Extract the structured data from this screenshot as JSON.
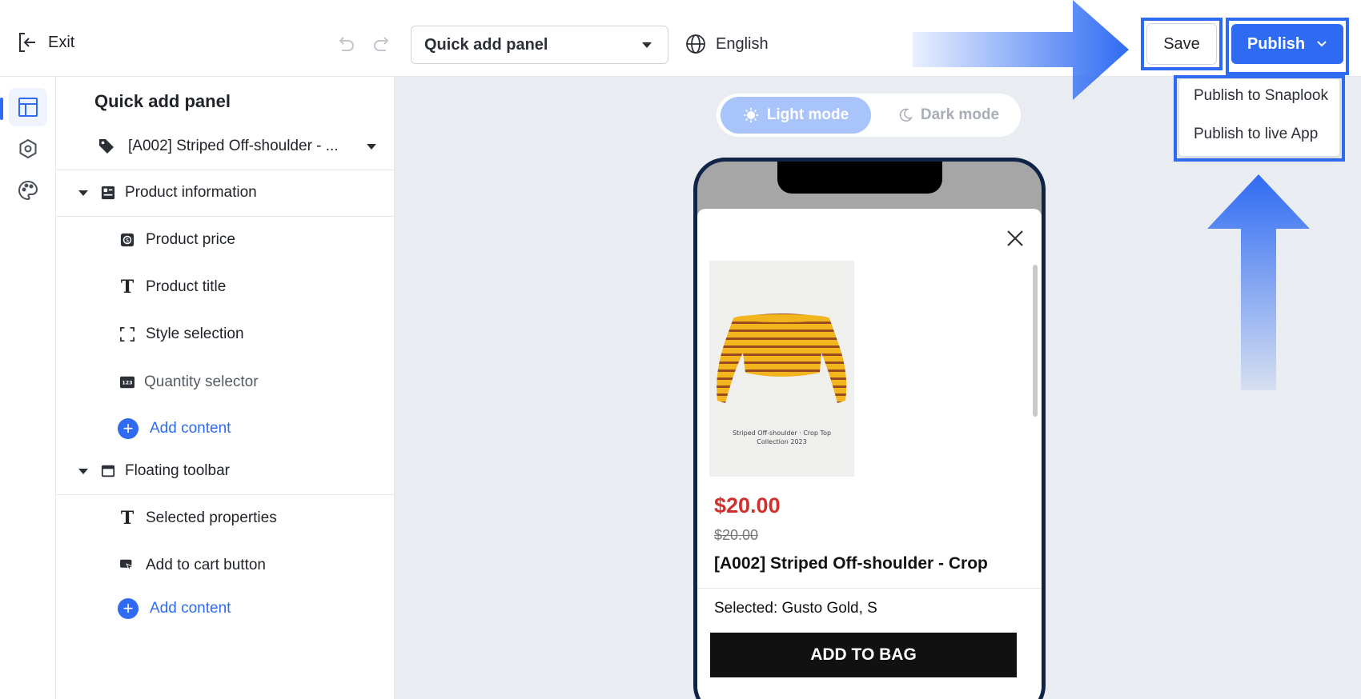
{
  "topbar": {
    "exit_label": "Exit",
    "panel_select_value": "Quick add panel",
    "language": "English",
    "save_label": "Save",
    "publish_label": "Publish"
  },
  "publish_menu": {
    "items": [
      "Publish to Snaplook",
      "Publish to live App"
    ]
  },
  "rail": {
    "items": [
      {
        "icon": "layout-icon",
        "active": true
      },
      {
        "icon": "settings-hex-icon",
        "active": false
      },
      {
        "icon": "palette-icon",
        "active": false
      }
    ]
  },
  "sidebar": {
    "title": "Quick add panel",
    "product_picker": "[A002] Striped Off-shoulder - ...",
    "sections": [
      {
        "label": "Product information",
        "items": [
          {
            "label": "Product price",
            "icon": "price-tag-icon"
          },
          {
            "label": "Product title",
            "icon": "text-icon"
          },
          {
            "label": "Style selection",
            "icon": "selection-icon"
          },
          {
            "label": "Quantity selector",
            "icon": "number-123-icon"
          }
        ],
        "add_label": "Add content"
      },
      {
        "label": "Floating toolbar",
        "items": [
          {
            "label": "Selected properties",
            "icon": "text-icon"
          },
          {
            "label": "Add to cart button",
            "icon": "cursor-button-icon"
          }
        ],
        "add_label": "Add content"
      }
    ]
  },
  "canvas": {
    "light_mode_label": "Light mode",
    "dark_mode_label": "Dark mode"
  },
  "preview": {
    "image_caption_line1": "Striped Off-shoulder · Crop Top",
    "image_caption_line2": "Collection 2023",
    "price": "$20.00",
    "compare_price": "$20.00",
    "product_name": "[A002] Striped Off-shoulder - Crop",
    "selected_text": "Selected: Gusto Gold, S",
    "add_to_bag_label": "ADD TO BAG"
  },
  "colors": {
    "accent": "#2f6bf2",
    "price_red": "#d0312d",
    "phone_frame": "#0f2447"
  }
}
